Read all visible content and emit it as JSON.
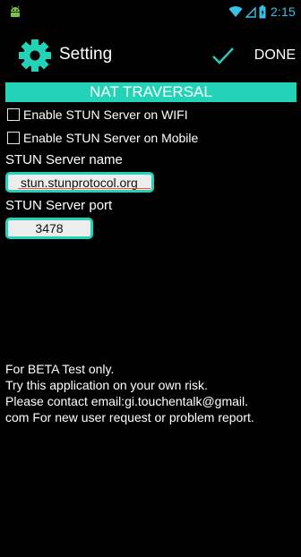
{
  "status_bar": {
    "time": "2:15",
    "notification_icon": "android-robot-icon",
    "icons": [
      "wifi-icon",
      "cell-signal-icon",
      "battery-icon"
    ],
    "accent_color": "#35c4e6"
  },
  "action_bar": {
    "title": "Setting",
    "app_icon": "gear-icon",
    "done_label": "DONE",
    "done_icon": "check-icon",
    "accent_color": "#22d3b8"
  },
  "section": {
    "title": "NAT TRAVERSAL",
    "color": "#22d3b8"
  },
  "options": {
    "stun_wifi": {
      "label": "Enable STUN Server on WIFI",
      "checked": false
    },
    "stun_mobile": {
      "label": "Enable STUN Server on Mobile",
      "checked": false
    }
  },
  "fields": {
    "server_name": {
      "label": "STUN Server name",
      "value": "stun.stunprotocol.org"
    },
    "server_port": {
      "label": "STUN Server port",
      "value": "3478"
    }
  },
  "notice": {
    "lines": [
      "For BETA Test only.",
      "Try this application on your own risk.",
      "Please contact email:gi.touchentalk@gmail.",
      "com For new user request or problem report."
    ]
  }
}
